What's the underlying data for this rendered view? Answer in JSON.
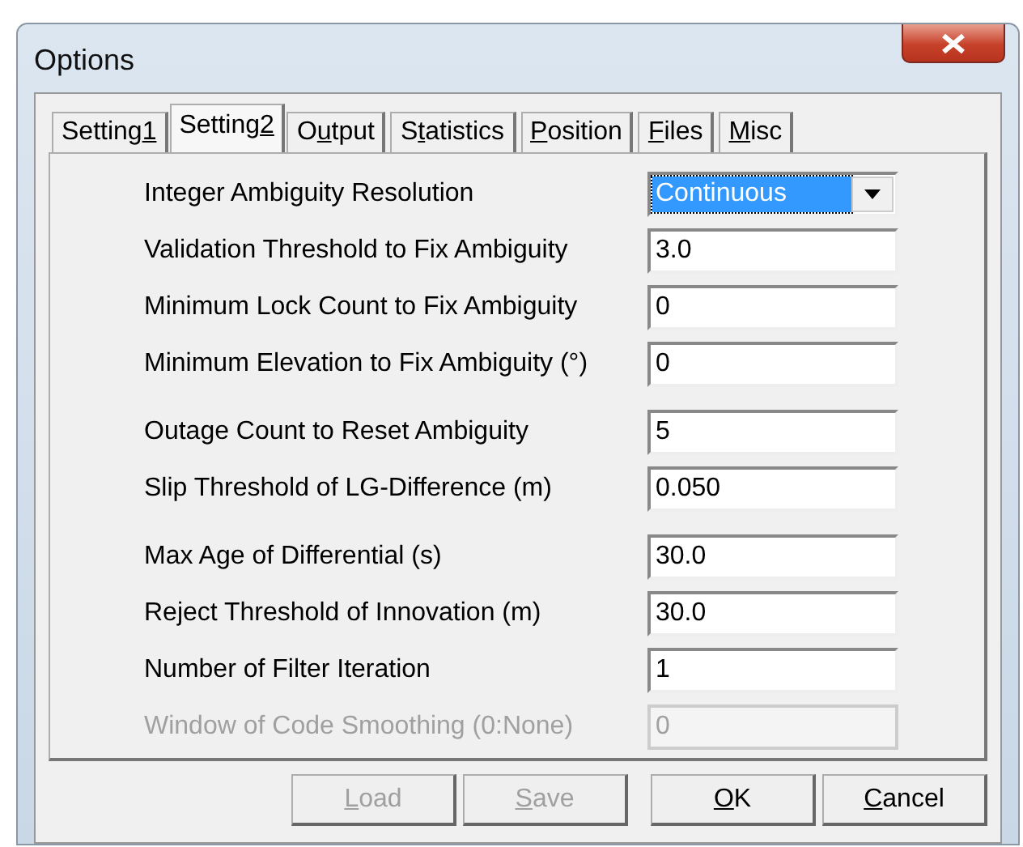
{
  "window": {
    "title": "Options"
  },
  "tabs": [
    {
      "pre": "Setting",
      "key": "1",
      "selected": false
    },
    {
      "pre": "Setting",
      "key": "2",
      "selected": true
    },
    {
      "pre": "O",
      "key": "u",
      "post": "tput",
      "selected": false
    },
    {
      "pre": "S",
      "key": "t",
      "post": "atistics",
      "selected": false
    },
    {
      "key": "P",
      "post": "osition",
      "selected": false
    },
    {
      "key": "F",
      "post": "iles",
      "selected": false
    },
    {
      "key": "M",
      "post": "isc",
      "selected": false
    }
  ],
  "groups": [
    {
      "rows": [
        {
          "label": "Integer Ambiguity Resolution",
          "kind": "select",
          "value": "Continuous",
          "disabled": false
        },
        {
          "label": "Validation Threshold to Fix Ambiguity",
          "kind": "text",
          "value": "3.0",
          "disabled": false
        },
        {
          "label": "Minimum Lock Count to Fix Ambiguity",
          "kind": "text",
          "value": "0",
          "disabled": false
        },
        {
          "label": "Minimum Elevation to Fix Ambiguity (°)",
          "kind": "text",
          "value": "0",
          "disabled": false
        }
      ]
    },
    {
      "rows": [
        {
          "label": "Outage Count to Reset Ambiguity",
          "kind": "text",
          "value": "5",
          "disabled": false
        },
        {
          "label": "Slip Threshold of LG-Difference (m)",
          "kind": "text",
          "value": "0.050",
          "disabled": false
        }
      ]
    },
    {
      "rows": [
        {
          "label": "Max Age of Differential (s)",
          "kind": "text",
          "value": "30.0",
          "disabled": false
        },
        {
          "label": "Reject Threshold of Innovation (m)",
          "kind": "text",
          "value": "30.0",
          "disabled": false
        },
        {
          "label": "Number of Filter Iteration",
          "kind": "text",
          "value": "1",
          "disabled": false
        },
        {
          "label": "Window of Code Smoothing (0:None)",
          "kind": "text",
          "value": "0",
          "disabled": true
        }
      ]
    }
  ],
  "buttons": [
    {
      "key": "L",
      "post": "oad",
      "disabled": true
    },
    {
      "key": "S",
      "post": "ave",
      "disabled": true
    },
    {
      "key": "O",
      "post": "K",
      "disabled": false
    },
    {
      "key": "C",
      "post": "ancel",
      "disabled": false
    }
  ]
}
